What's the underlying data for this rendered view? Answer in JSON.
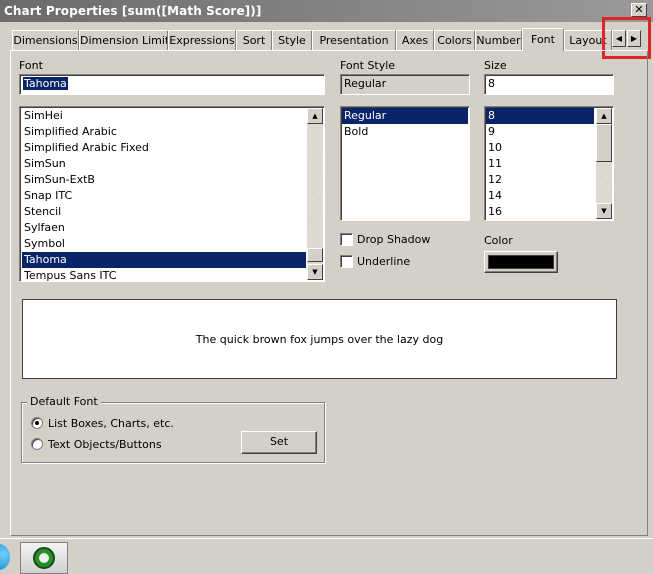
{
  "window": {
    "title": "Chart Properties [sum([Math Score])]",
    "close_glyph": "✕"
  },
  "tabs": [
    "Dimensions",
    "Dimension Limits",
    "Expressions",
    "Sort",
    "Style",
    "Presentation",
    "Axes",
    "Colors",
    "Number",
    "Font",
    "Layout"
  ],
  "active_tab": "Font",
  "font": {
    "label": "Font",
    "value": "Tahoma",
    "list": [
      "SimHei",
      "Simplified Arabic",
      "Simplified Arabic Fixed",
      "SimSun",
      "SimSun-ExtB",
      "Snap ITC",
      "Stencil",
      "Sylfaen",
      "Symbol",
      "Tahoma",
      "Tempus Sans ITC"
    ],
    "selected": "Tahoma"
  },
  "font_style": {
    "label": "Font Style",
    "value": "Regular",
    "list": [
      "Regular",
      "Bold"
    ],
    "selected": "Regular"
  },
  "size": {
    "label": "Size",
    "value": "8",
    "list": [
      "8",
      "9",
      "10",
      "11",
      "12",
      "14",
      "16"
    ],
    "selected": "8"
  },
  "effects": {
    "drop_shadow": {
      "label": "Drop Shadow",
      "checked": false
    },
    "underline": {
      "label": "Underline",
      "checked": false
    }
  },
  "color": {
    "label": "Color",
    "value": "#000000"
  },
  "preview": {
    "text": "The quick brown fox jumps over the lazy dog"
  },
  "default_font": {
    "label": "Default Font",
    "options": [
      {
        "label": "List Boxes, Charts, etc.",
        "selected": true
      },
      {
        "label": "Text Objects/Buttons",
        "selected": false
      }
    ],
    "set_button": "Set"
  },
  "icons": {
    "taskbar": [
      "app-icon-blue",
      "qlikview-icon"
    ]
  }
}
